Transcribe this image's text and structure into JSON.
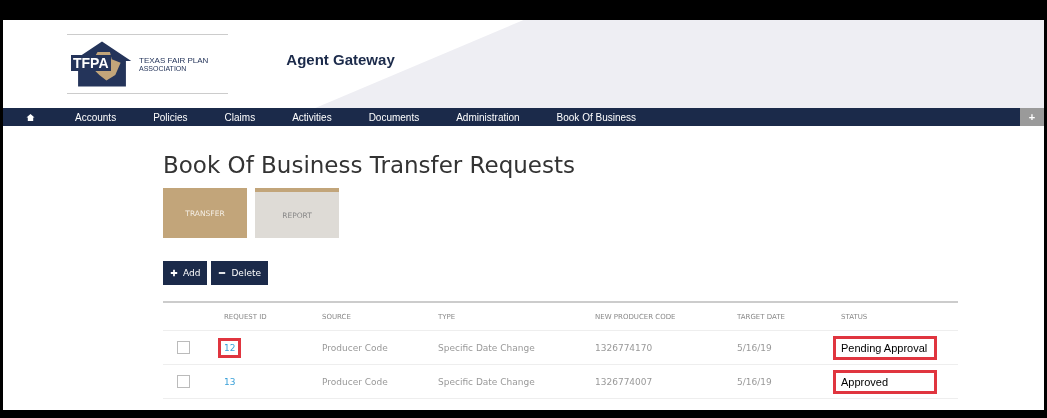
{
  "header": {
    "logo_text": "TFPA",
    "org_name": "TEXAS FAIR PLAN",
    "org_sub": "ASSOCIATION",
    "app_title": "Agent Gateway"
  },
  "nav": {
    "items": [
      {
        "label": "Accounts"
      },
      {
        "label": "Policies"
      },
      {
        "label": "Claims"
      },
      {
        "label": "Activities"
      },
      {
        "label": "Documents"
      },
      {
        "label": "Administration"
      },
      {
        "label": "Book Of Business"
      }
    ],
    "extra": "+"
  },
  "page_title": "Book Of Business Transfer Requests",
  "tabs": [
    {
      "label": "TRANSFER",
      "selected": true
    },
    {
      "label": "REPORT",
      "selected": false
    }
  ],
  "buttons": [
    {
      "kind": "add",
      "label": "Add"
    },
    {
      "kind": "delete",
      "label": "Delete"
    }
  ],
  "table": {
    "columns": [
      "REQUEST ID",
      "SOURCE",
      "TYPE",
      "NEW PRODUCER CODE",
      "TARGET DATE",
      "STATUS"
    ],
    "rows": [
      {
        "checked": false,
        "request_id": "12",
        "request_id_highlighted": true,
        "source": "Producer Code",
        "type": "Specific Date Change",
        "new_producer_code": "1326774170",
        "target_date": "5/16/19",
        "status": "Pending Approval",
        "status_highlighted": true
      },
      {
        "checked": false,
        "request_id": "13",
        "request_id_highlighted": false,
        "source": "Producer Code",
        "type": "Specific Date Change",
        "new_producer_code": "1326774007",
        "target_date": "5/16/19",
        "status": "Approved",
        "status_highlighted": true
      }
    ]
  }
}
